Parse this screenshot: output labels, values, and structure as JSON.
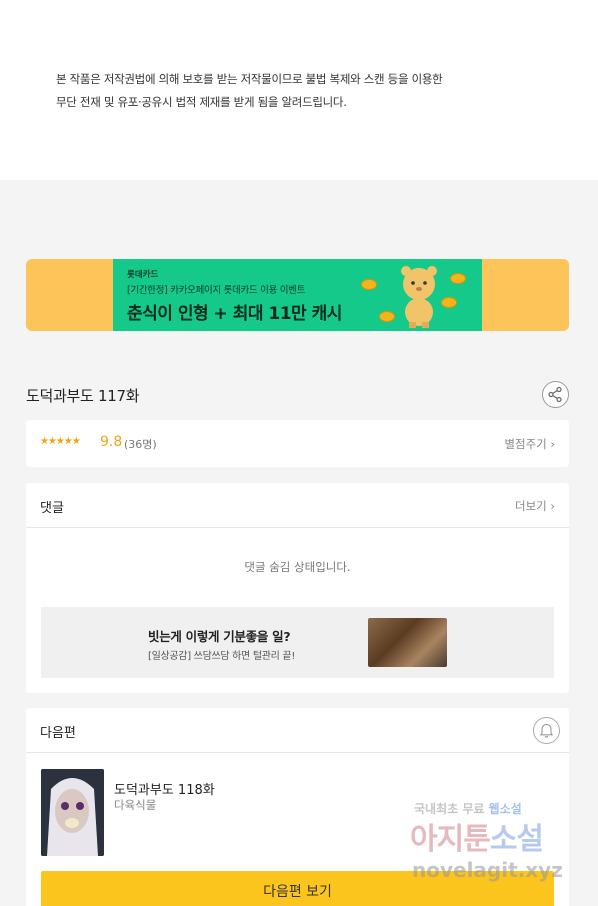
{
  "notice": {
    "line1": "본 작품은 저작권법에 의해 보호를 받는 저작물이므로 불법 복제와 스캔 등을 이용한",
    "line2": "무단 전재 및 유포·공유시 법적 제재를 받게 됨을 알려드립니다."
  },
  "banner": {
    "brand": "롯데카드",
    "subtitle": "[기간한정] 카카오페이지 롯데카드 이용 이벤트",
    "headline": "춘식이 인형 + 최대 11만 캐시"
  },
  "episode": {
    "title": "도덕과부도 117화",
    "share_icon": "share-icon"
  },
  "rating": {
    "stars": "★★★★★",
    "score": "9.8",
    "count": "(36명)",
    "rate_link": "별점주기 ›"
  },
  "comments": {
    "title": "댓글",
    "more_link": "더보기 ›",
    "hidden_message": "댓글 숨김 상태입니다."
  },
  "ad": {
    "title": "빗는게 이렇게 기분좋을 일?",
    "subtitle": "[일상공감] 쓰담쓰담 하면 털관리 끝!"
  },
  "next_episode": {
    "section_title": "다음편",
    "bell_icon": "bell-icon",
    "title": "도덕과부도 118화",
    "author": "다육식물",
    "button_label": "다음편 보기"
  },
  "watermark": {
    "line1_prefix": "국내최초 무료 ",
    "line1_highlight": "웹소설",
    "line2_prefix": "아지툰",
    "line2_highlight": "소설",
    "line3": "novelagit.xyz"
  },
  "colors": {
    "accent_yellow": "#fcc51e",
    "star_orange": "#f0a418",
    "banner_green": "#15c98a",
    "banner_bg": "#fdc45a"
  }
}
